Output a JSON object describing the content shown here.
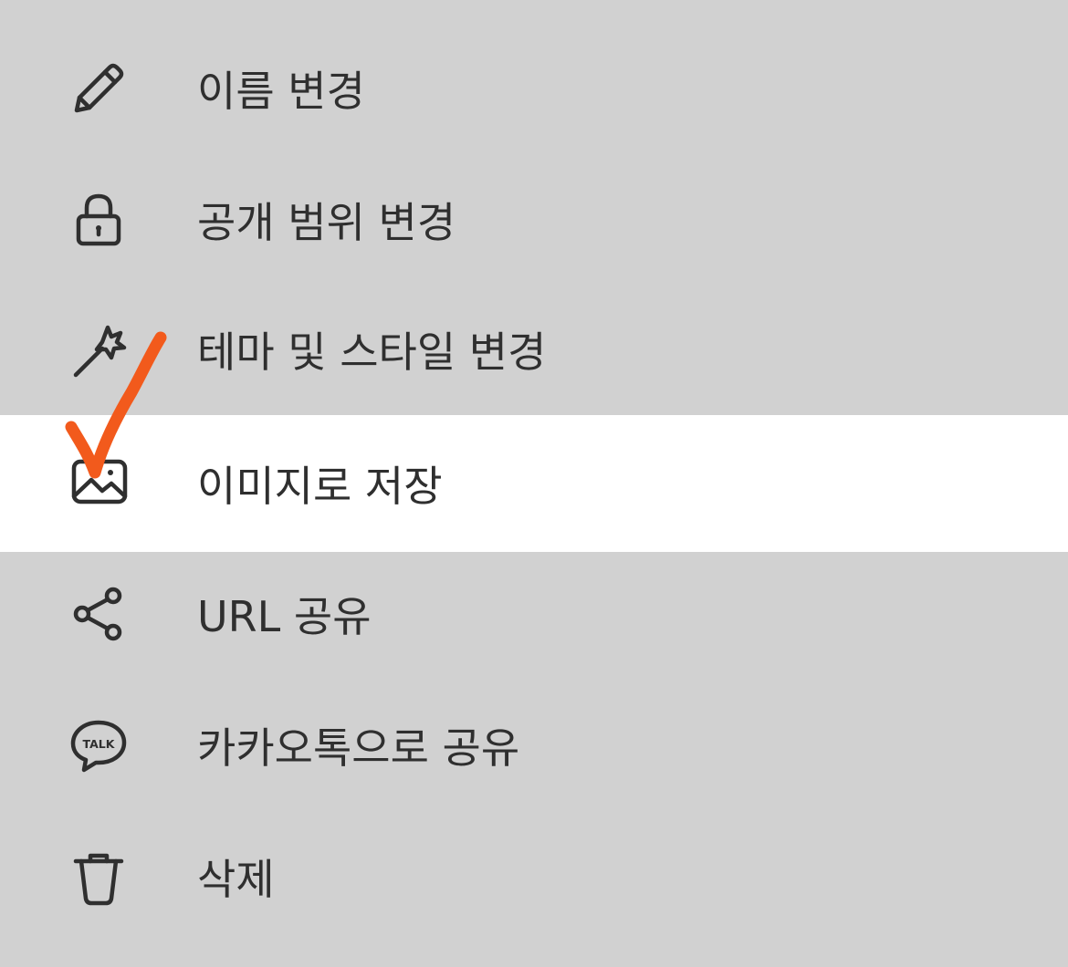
{
  "menu": {
    "items": [
      {
        "label": "이름 변경",
        "icon": "pencil-icon"
      },
      {
        "label": "공개 범위 변경",
        "icon": "lock-icon"
      },
      {
        "label": "테마 및 스타일 변경",
        "icon": "magic-wand-icon"
      },
      {
        "label": "이미지로 저장",
        "icon": "image-icon",
        "highlighted": true
      },
      {
        "label": "URL 공유",
        "icon": "share-icon"
      },
      {
        "label": "카카오톡으로 공유",
        "icon": "kakaotalk-icon",
        "icon_text": "TALK"
      },
      {
        "label": "삭제",
        "icon": "trash-icon"
      }
    ]
  },
  "colors": {
    "background": "#d1d1d1",
    "highlight": "#ffffff",
    "text": "#2f2f2f",
    "annotation": "#f25a1c"
  }
}
